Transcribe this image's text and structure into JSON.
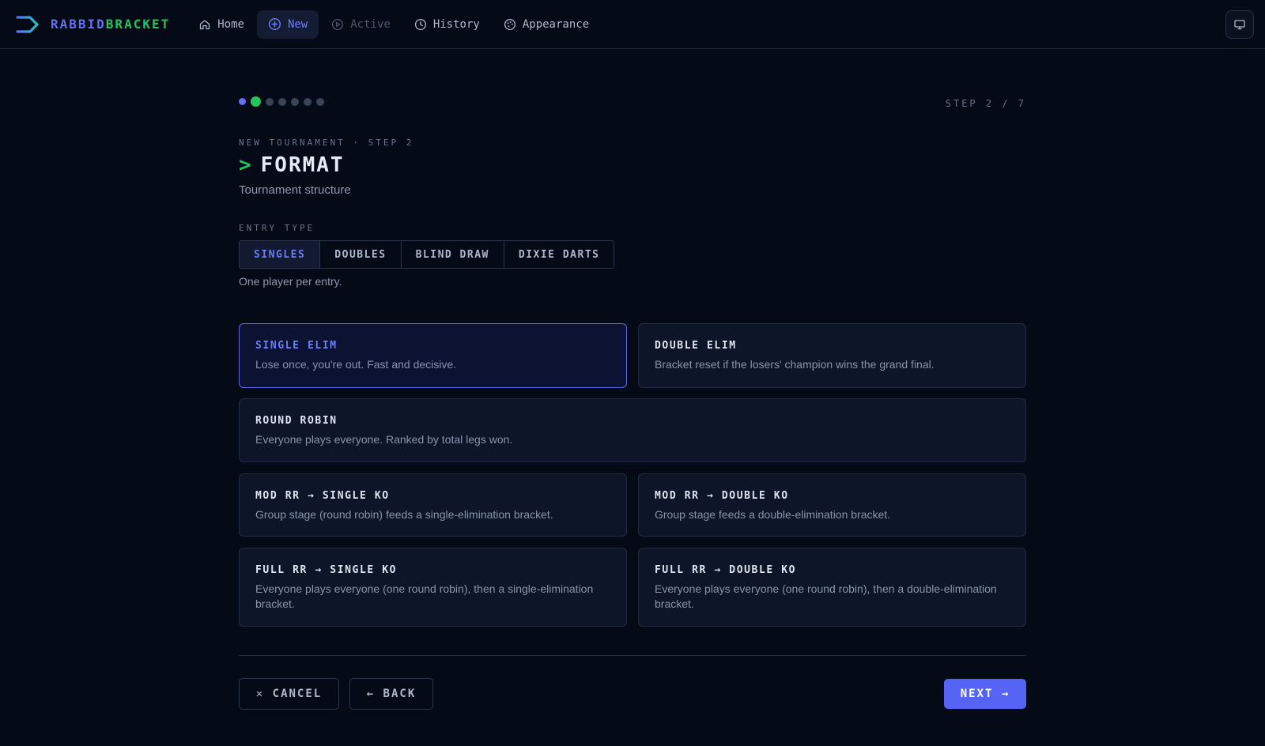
{
  "app": {
    "brand_part1": "RABBID",
    "brand_part2": "BRACKET",
    "colors": {
      "accent": "#6270f2",
      "success": "#22c55e",
      "background": "#050a17"
    }
  },
  "nav": {
    "items": [
      {
        "label": "Home",
        "icon": "home-icon",
        "state": "normal"
      },
      {
        "label": "New",
        "icon": "plus-circle-icon",
        "state": "active"
      },
      {
        "label": "Active",
        "icon": "play-circle-icon",
        "state": "disabled"
      },
      {
        "label": "History",
        "icon": "clock-icon",
        "state": "normal"
      },
      {
        "label": "Appearance",
        "icon": "palette-icon",
        "state": "normal"
      }
    ],
    "right_icon": "monitor-icon"
  },
  "wizard": {
    "total_steps": 7,
    "current_step": 2,
    "step_counter": "STEP 2 / 7",
    "eyebrow": "NEW TOURNAMENT · STEP 2",
    "prompt_symbol": ">",
    "title": "FORMAT",
    "subtitle": "Tournament structure"
  },
  "entry_type": {
    "label": "ENTRY TYPE",
    "options": [
      "SINGLES",
      "DOUBLES",
      "BLIND DRAW",
      "DIXIE DARTS"
    ],
    "selected": "SINGLES",
    "hint": "One player per entry."
  },
  "formats": [
    {
      "title": "SINGLE ELIM",
      "desc": "Lose once, you're out. Fast and decisive.",
      "selected": true
    },
    {
      "title": "DOUBLE ELIM",
      "desc": "Bracket reset if the losers' champion wins the grand final.",
      "selected": false
    },
    {
      "title": "ROUND ROBIN",
      "desc": "Everyone plays everyone. Ranked by total legs won.",
      "selected": false
    },
    {
      "title": "MOD RR → SINGLE KO",
      "desc": "Group stage (round robin) feeds a single-elimination bracket.",
      "selected": false
    },
    {
      "title": "MOD RR → DOUBLE KO",
      "desc": "Group stage feeds a double-elimination bracket.",
      "selected": false
    },
    {
      "title": "FULL RR → SINGLE KO",
      "desc": "Everyone plays everyone (one round robin), then a single-elimination bracket.",
      "selected": false
    },
    {
      "title": "FULL RR → DOUBLE KO",
      "desc": "Everyone plays everyone (one round robin), then a double-elimination bracket.",
      "selected": false
    }
  ],
  "actions": {
    "cancel": "✕ CANCEL",
    "back": "← BACK",
    "next": "NEXT →"
  }
}
